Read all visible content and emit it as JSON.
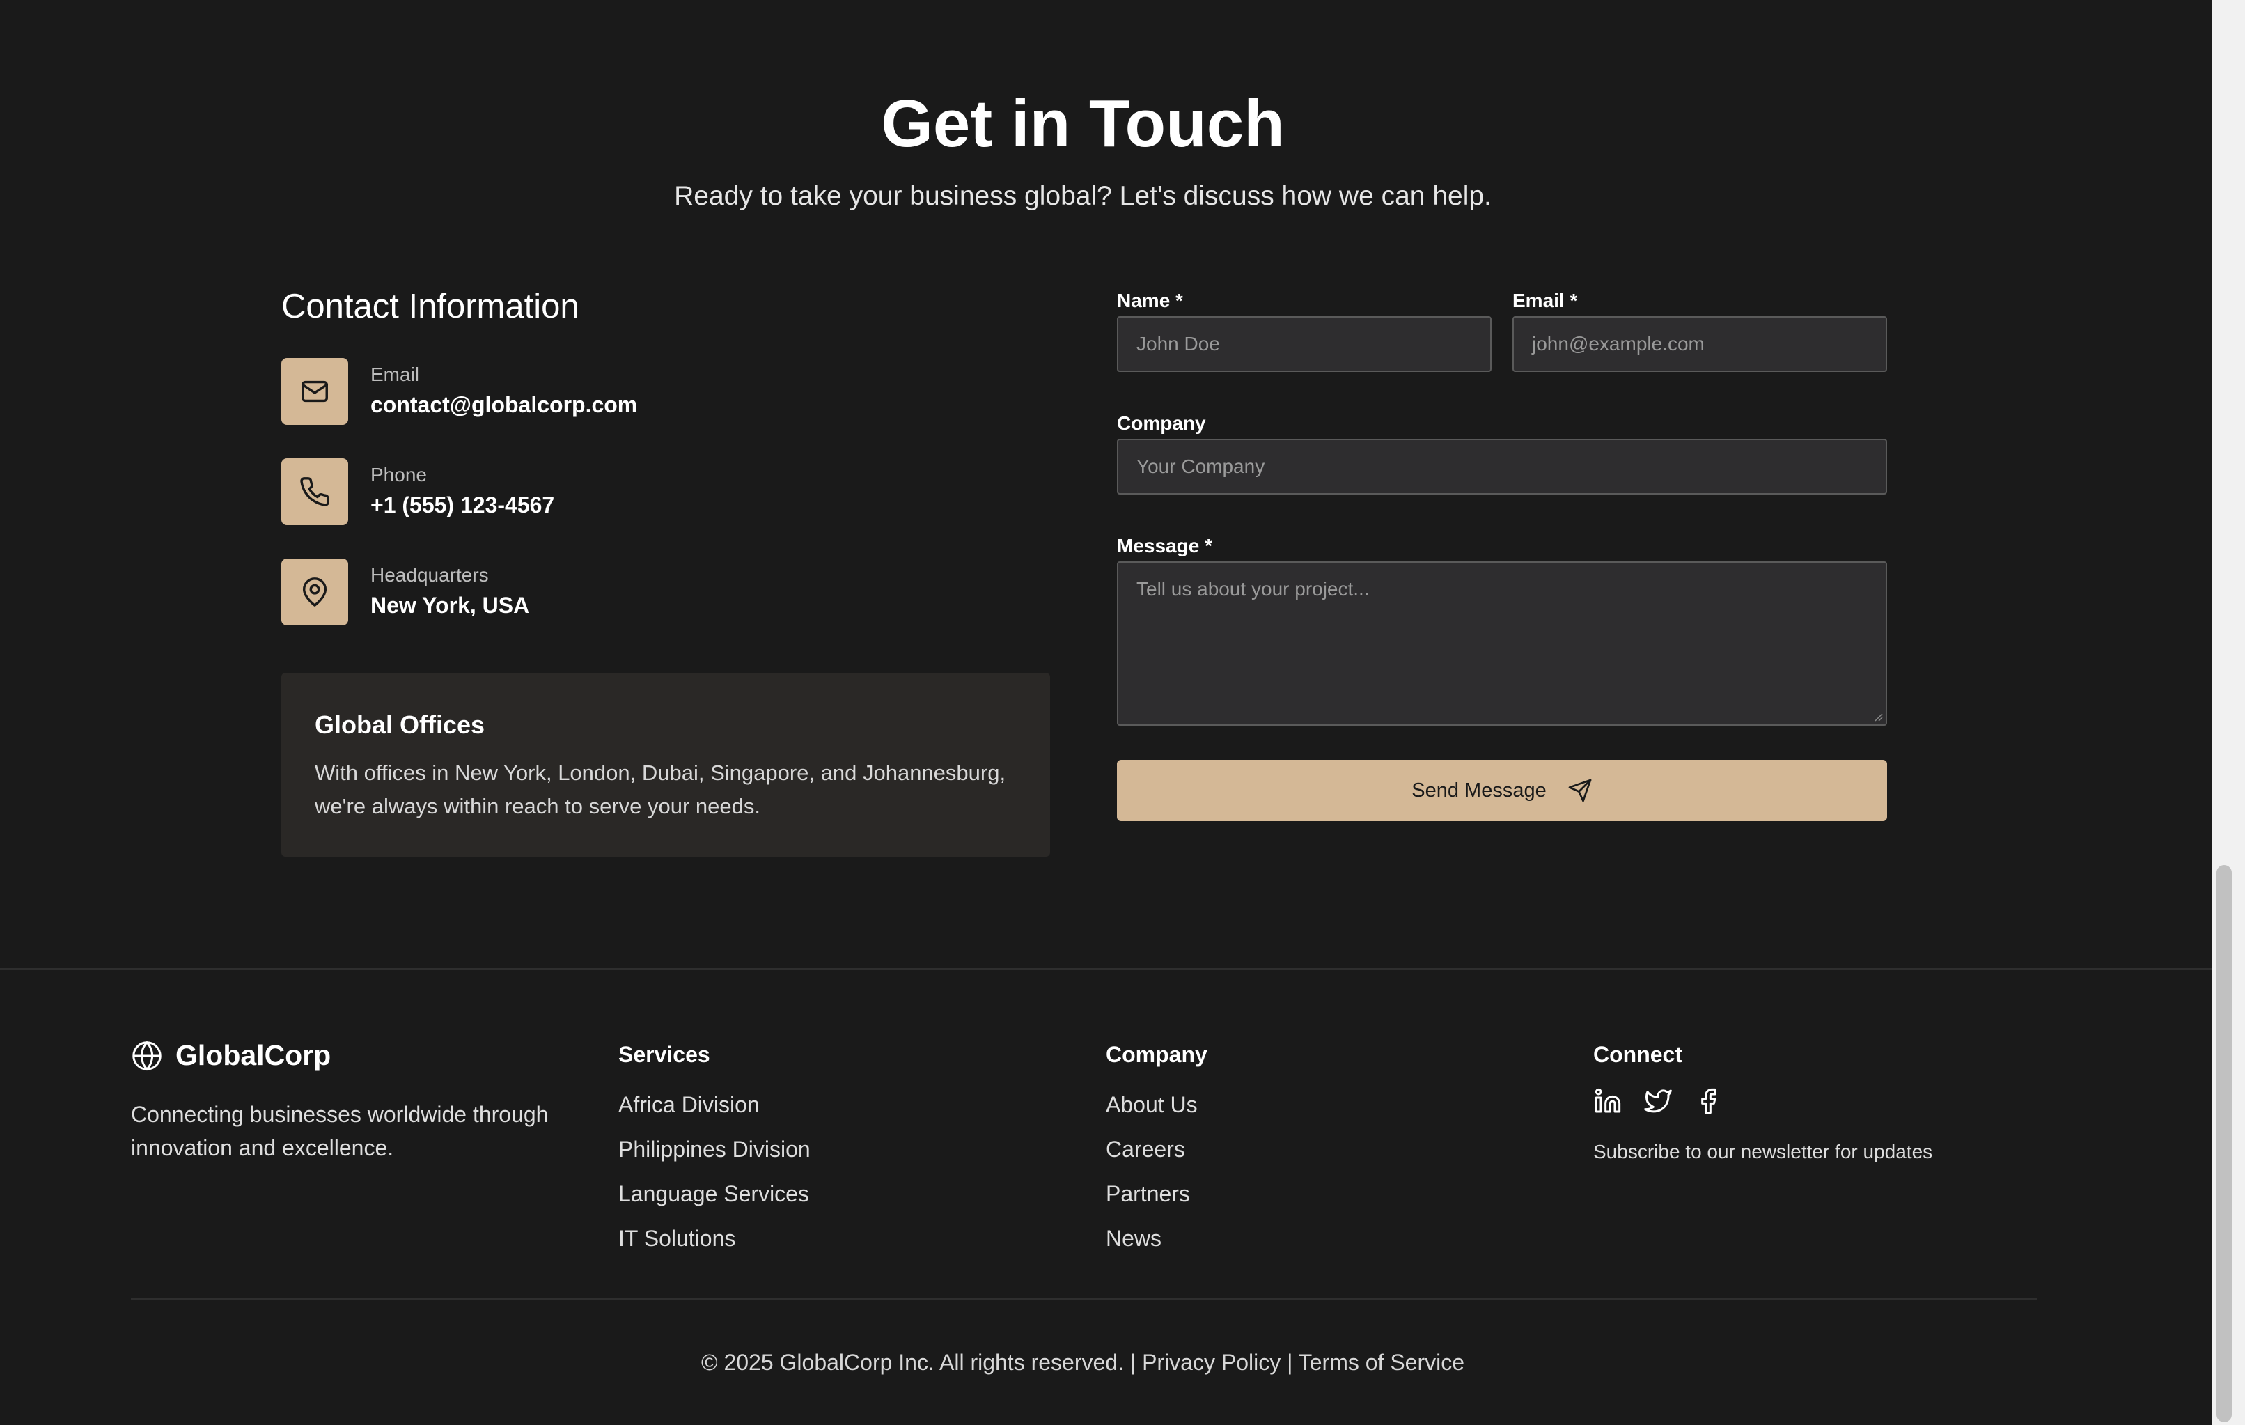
{
  "hero": {
    "title": "Get in Touch",
    "subtitle": "Ready to take your business global? Let's discuss how we can help."
  },
  "contact": {
    "heading": "Contact Information",
    "items": [
      {
        "icon": "mail-icon",
        "label": "Email",
        "value": "contact@globalcorp.com"
      },
      {
        "icon": "phone-icon",
        "label": "Phone",
        "value": "+1 (555) 123-4567"
      },
      {
        "icon": "map-pin-icon",
        "label": "Headquarters",
        "value": "New York, USA"
      }
    ],
    "offices": {
      "title": "Global Offices",
      "text": "With offices in New York, London, Dubai, Singapore, and Johannesburg, we're always within reach to serve your needs."
    }
  },
  "form": {
    "name_label": "Name *",
    "name_placeholder": "John Doe",
    "email_label": "Email *",
    "email_placeholder": "john@example.com",
    "company_label": "Company",
    "company_placeholder": "Your Company",
    "message_label": "Message *",
    "message_placeholder": "Tell us about your project...",
    "submit_label": "Send Message"
  },
  "footer": {
    "brand": "GlobalCorp",
    "tagline": "Connecting businesses worldwide through innovation and excellence.",
    "services": {
      "heading": "Services",
      "links": [
        "Africa Division",
        "Philippines Division",
        "Language Services",
        "IT Solutions"
      ]
    },
    "company": {
      "heading": "Company",
      "links": [
        "About Us",
        "Careers",
        "Partners",
        "News"
      ]
    },
    "connect": {
      "heading": "Connect",
      "icons": [
        "linkedin-icon",
        "twitter-icon",
        "facebook-icon"
      ],
      "newsletter": "Subscribe to our newsletter for updates"
    },
    "copyright": "© 2025 GlobalCorp Inc. All rights reserved. | Privacy Policy | Terms of Service"
  },
  "colors": {
    "background": "#1a1a1a",
    "accent": "#d4b896",
    "card": "#2a2826",
    "input": "#2e2d2f"
  }
}
